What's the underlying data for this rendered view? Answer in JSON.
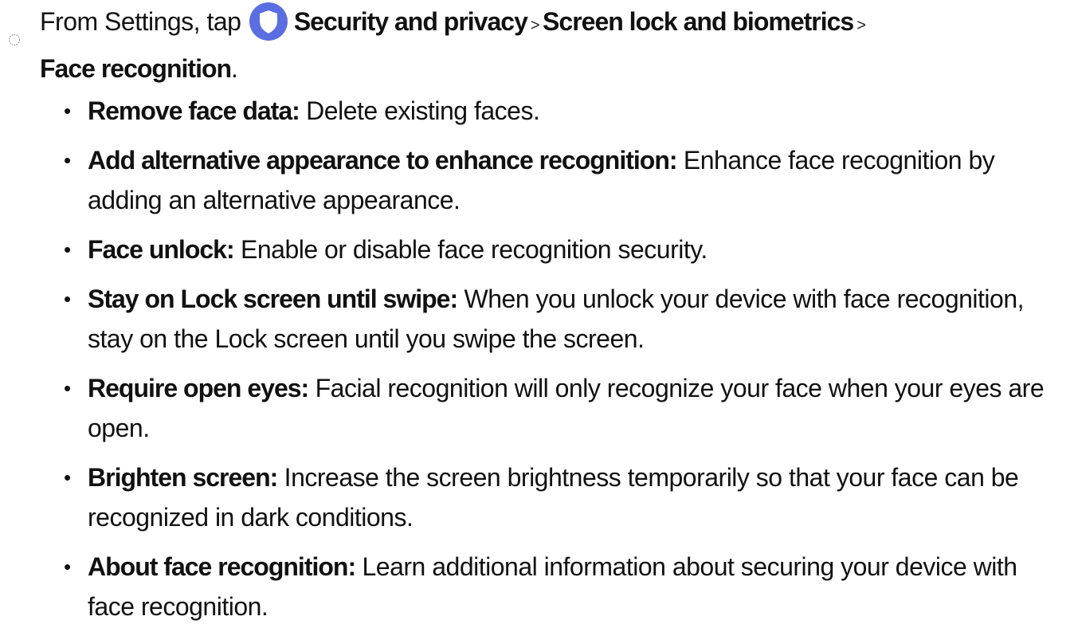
{
  "intro": {
    "prefix": "From Settings, tap",
    "path": [
      "Security and privacy",
      "Screen lock and biometrics",
      "Face recognition"
    ],
    "separator": ">",
    "end": ".",
    "icon": "shield-icon",
    "icon_color": "#5b6ee1"
  },
  "options": [
    {
      "term": "Remove face data:",
      "desc": "Delete existing faces."
    },
    {
      "term": "Add alternative appearance to enhance recognition:",
      "desc": "Enhance face recognition by adding an alternative appearance."
    },
    {
      "term": "Face unlock:",
      "desc": "Enable or disable face recognition security."
    },
    {
      "term": "Stay on Lock screen until swipe:",
      "desc": "When you unlock your device with face recognition, stay on the Lock screen until you swipe the screen."
    },
    {
      "term": "Require open eyes:",
      "desc": "Facial recognition will only recognize your face when your eyes are open."
    },
    {
      "term": "Brighten screen:",
      "desc": "Increase the screen brightness temporarily so that your face can be recognized in dark conditions."
    },
    {
      "term": "About face recognition:",
      "desc": "Learn additional information about securing your device with face recognition."
    }
  ]
}
